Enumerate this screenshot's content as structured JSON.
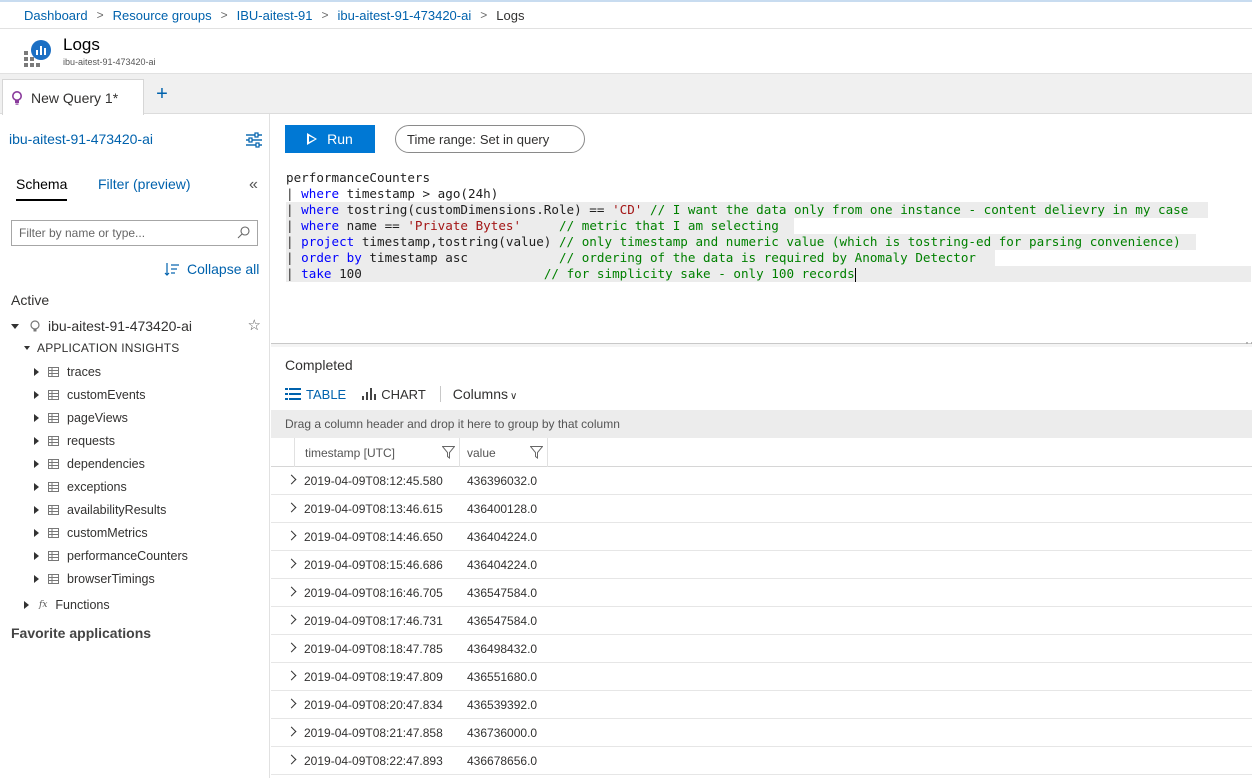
{
  "breadcrumb": {
    "items": [
      "Dashboard",
      "Resource groups",
      "IBU-aitest-91",
      "ibu-aitest-91-473420-ai"
    ],
    "current": "Logs"
  },
  "blade": {
    "title": "Logs",
    "subtitle": "ibu-aitest-91-473420-ai"
  },
  "tabs": {
    "query_tab": "New Query 1*",
    "add_tab": "+"
  },
  "sidebar": {
    "resource": "ibu-aitest-91-473420-ai",
    "schema_tab": "Schema",
    "filter_tab": "Filter (preview)",
    "collapse_panel": "«",
    "filter_placeholder": "Filter by name or type...",
    "collapse_all": "Collapse all",
    "active_label": "Active",
    "active_resource": "ibu-aitest-91-473420-ai",
    "group_label": "APPLICATION INSIGHTS",
    "tables": [
      "traces",
      "customEvents",
      "pageViews",
      "requests",
      "dependencies",
      "exceptions",
      "availabilityResults",
      "customMetrics",
      "performanceCounters",
      "browserTimings"
    ],
    "functions_label": "Functions",
    "functions_icon": "fx",
    "favorites_label": "Favorite applications"
  },
  "toolbar": {
    "run_label": "Run",
    "time_range_label": "Time range:",
    "time_range_value": "Set in query"
  },
  "editor": {
    "lines": [
      [
        {
          "t": "plain",
          "v": "performanceCounters"
        }
      ],
      [
        {
          "t": "pipe",
          "v": "| "
        },
        {
          "t": "kw",
          "v": "where"
        },
        {
          "t": "plain",
          "v": " timestamp > ago(24h)"
        }
      ],
      [
        {
          "t": "pipe",
          "v": "| "
        },
        {
          "t": "kw",
          "v": "where"
        },
        {
          "t": "plain",
          "v": " tostring(customDimensions.Role) == "
        },
        {
          "t": "str",
          "v": "'CD'"
        },
        {
          "t": "plain",
          "v": " "
        },
        {
          "t": "cm",
          "v": "// I want the data only from one instance - content delievry in my case"
        }
      ],
      [
        {
          "t": "pipe",
          "v": "| "
        },
        {
          "t": "kw",
          "v": "where"
        },
        {
          "t": "plain",
          "v": " name == "
        },
        {
          "t": "str",
          "v": "'Private Bytes'"
        },
        {
          "t": "plain",
          "v": "     "
        },
        {
          "t": "cm",
          "v": "// metric that I am selecting"
        }
      ],
      [
        {
          "t": "pipe",
          "v": "| "
        },
        {
          "t": "kw",
          "v": "project"
        },
        {
          "t": "plain",
          "v": " timestamp,tostring(value) "
        },
        {
          "t": "cm",
          "v": "// only timestamp and numeric value (which is tostring-ed for parsing convenience)"
        }
      ],
      [
        {
          "t": "pipe",
          "v": "| "
        },
        {
          "t": "kw",
          "v": "order by"
        },
        {
          "t": "plain",
          "v": " timestamp asc            "
        },
        {
          "t": "cm",
          "v": "// ordering of the data is required by Anomaly Detector"
        }
      ],
      [
        {
          "t": "pipe",
          "v": "| "
        },
        {
          "t": "kw",
          "v": "take"
        },
        {
          "t": "plain",
          "v": " 100                        "
        },
        {
          "t": "cm",
          "v": "// for simplicity sake - only 100 records"
        }
      ]
    ]
  },
  "results": {
    "status": "Completed",
    "table_tab": "TABLE",
    "chart_tab": "CHART",
    "columns_label": "Columns",
    "group_hint": "Drag a column header and drop it here to group by that column",
    "columns": [
      "timestamp [UTC]",
      "value"
    ],
    "rows": [
      [
        "2019-04-09T08:12:45.580",
        "436396032.0"
      ],
      [
        "2019-04-09T08:13:46.615",
        "436400128.0"
      ],
      [
        "2019-04-09T08:14:46.650",
        "436404224.0"
      ],
      [
        "2019-04-09T08:15:46.686",
        "436404224.0"
      ],
      [
        "2019-04-09T08:16:46.705",
        "436547584.0"
      ],
      [
        "2019-04-09T08:17:46.731",
        "436547584.0"
      ],
      [
        "2019-04-09T08:18:47.785",
        "436498432.0"
      ],
      [
        "2019-04-09T08:19:47.809",
        "436551680.0"
      ],
      [
        "2019-04-09T08:20:47.834",
        "436539392.0"
      ],
      [
        "2019-04-09T08:21:47.858",
        "436736000.0"
      ],
      [
        "2019-04-09T08:22:47.893",
        "436678656.0"
      ]
    ]
  },
  "colors": {
    "accent": "#0078d4",
    "link": "#0062ad",
    "keyword": "#0000ff",
    "string": "#a31515",
    "comment": "#008000"
  }
}
